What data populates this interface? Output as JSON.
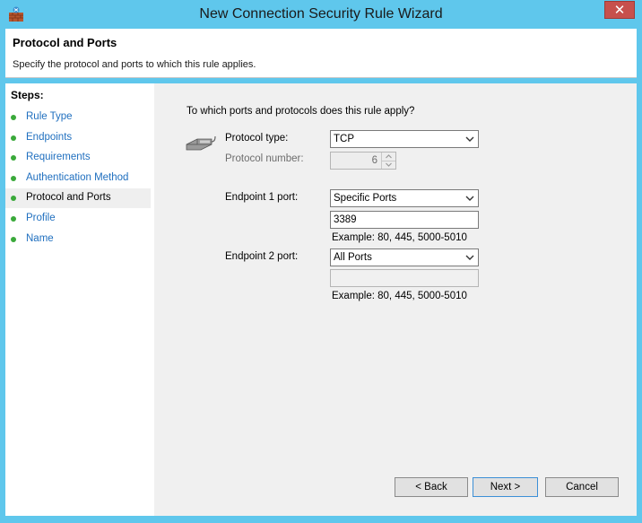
{
  "window": {
    "title": "New Connection Security Rule Wizard",
    "close_glyph": "✕",
    "icon": "firewall-wall-icon"
  },
  "header": {
    "title": "Protocol and Ports",
    "subtitle": "Specify the protocol and ports to which this rule applies."
  },
  "steps": {
    "title": "Steps:",
    "items": [
      {
        "label": "Rule Type",
        "active": false
      },
      {
        "label": "Endpoints",
        "active": false
      },
      {
        "label": "Requirements",
        "active": false
      },
      {
        "label": "Authentication Method",
        "active": false
      },
      {
        "label": "Protocol and Ports",
        "active": true
      },
      {
        "label": "Profile",
        "active": false
      },
      {
        "label": "Name",
        "active": false
      }
    ]
  },
  "form": {
    "question": "To which ports and protocols does this rule apply?",
    "protocol_type_label": "Protocol type:",
    "protocol_type_value": "TCP",
    "protocol_number_label": "Protocol number:",
    "protocol_number_value": "6",
    "endpoint1_label": "Endpoint 1 port:",
    "endpoint1_select": "Specific Ports",
    "endpoint1_ports": "3389",
    "endpoint1_example": "Example: 80, 445, 5000-5010",
    "endpoint2_label": "Endpoint 2 port:",
    "endpoint2_select": "All Ports",
    "endpoint2_ports": "",
    "endpoint2_example": "Example: 80, 445, 5000-5010"
  },
  "buttons": {
    "back": "< Back",
    "next": "Next >",
    "cancel": "Cancel"
  },
  "colors": {
    "frame": "#5fc7ec",
    "close": "#c7504c",
    "step_dot": "#3aa93a",
    "step_link": "#1f6fbf"
  }
}
